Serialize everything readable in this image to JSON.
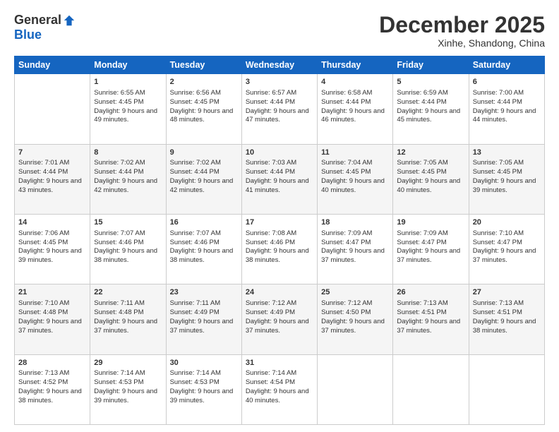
{
  "logo": {
    "general": "General",
    "blue": "Blue"
  },
  "header": {
    "month": "December 2025",
    "location": "Xinhe, Shandong, China"
  },
  "weekdays": [
    "Sunday",
    "Monday",
    "Tuesday",
    "Wednesday",
    "Thursday",
    "Friday",
    "Saturday"
  ],
  "weeks": [
    [
      {
        "day": "",
        "sunrise": "",
        "sunset": "",
        "daylight": ""
      },
      {
        "day": "1",
        "sunrise": "Sunrise: 6:55 AM",
        "sunset": "Sunset: 4:45 PM",
        "daylight": "Daylight: 9 hours and 49 minutes."
      },
      {
        "day": "2",
        "sunrise": "Sunrise: 6:56 AM",
        "sunset": "Sunset: 4:45 PM",
        "daylight": "Daylight: 9 hours and 48 minutes."
      },
      {
        "day": "3",
        "sunrise": "Sunrise: 6:57 AM",
        "sunset": "Sunset: 4:44 PM",
        "daylight": "Daylight: 9 hours and 47 minutes."
      },
      {
        "day": "4",
        "sunrise": "Sunrise: 6:58 AM",
        "sunset": "Sunset: 4:44 PM",
        "daylight": "Daylight: 9 hours and 46 minutes."
      },
      {
        "day": "5",
        "sunrise": "Sunrise: 6:59 AM",
        "sunset": "Sunset: 4:44 PM",
        "daylight": "Daylight: 9 hours and 45 minutes."
      },
      {
        "day": "6",
        "sunrise": "Sunrise: 7:00 AM",
        "sunset": "Sunset: 4:44 PM",
        "daylight": "Daylight: 9 hours and 44 minutes."
      }
    ],
    [
      {
        "day": "7",
        "sunrise": "Sunrise: 7:01 AM",
        "sunset": "Sunset: 4:44 PM",
        "daylight": "Daylight: 9 hours and 43 minutes."
      },
      {
        "day": "8",
        "sunrise": "Sunrise: 7:02 AM",
        "sunset": "Sunset: 4:44 PM",
        "daylight": "Daylight: 9 hours and 42 minutes."
      },
      {
        "day": "9",
        "sunrise": "Sunrise: 7:02 AM",
        "sunset": "Sunset: 4:44 PM",
        "daylight": "Daylight: 9 hours and 42 minutes."
      },
      {
        "day": "10",
        "sunrise": "Sunrise: 7:03 AM",
        "sunset": "Sunset: 4:44 PM",
        "daylight": "Daylight: 9 hours and 41 minutes."
      },
      {
        "day": "11",
        "sunrise": "Sunrise: 7:04 AM",
        "sunset": "Sunset: 4:45 PM",
        "daylight": "Daylight: 9 hours and 40 minutes."
      },
      {
        "day": "12",
        "sunrise": "Sunrise: 7:05 AM",
        "sunset": "Sunset: 4:45 PM",
        "daylight": "Daylight: 9 hours and 40 minutes."
      },
      {
        "day": "13",
        "sunrise": "Sunrise: 7:05 AM",
        "sunset": "Sunset: 4:45 PM",
        "daylight": "Daylight: 9 hours and 39 minutes."
      }
    ],
    [
      {
        "day": "14",
        "sunrise": "Sunrise: 7:06 AM",
        "sunset": "Sunset: 4:45 PM",
        "daylight": "Daylight: 9 hours and 39 minutes."
      },
      {
        "day": "15",
        "sunrise": "Sunrise: 7:07 AM",
        "sunset": "Sunset: 4:46 PM",
        "daylight": "Daylight: 9 hours and 38 minutes."
      },
      {
        "day": "16",
        "sunrise": "Sunrise: 7:07 AM",
        "sunset": "Sunset: 4:46 PM",
        "daylight": "Daylight: 9 hours and 38 minutes."
      },
      {
        "day": "17",
        "sunrise": "Sunrise: 7:08 AM",
        "sunset": "Sunset: 4:46 PM",
        "daylight": "Daylight: 9 hours and 38 minutes."
      },
      {
        "day": "18",
        "sunrise": "Sunrise: 7:09 AM",
        "sunset": "Sunset: 4:47 PM",
        "daylight": "Daylight: 9 hours and 37 minutes."
      },
      {
        "day": "19",
        "sunrise": "Sunrise: 7:09 AM",
        "sunset": "Sunset: 4:47 PM",
        "daylight": "Daylight: 9 hours and 37 minutes."
      },
      {
        "day": "20",
        "sunrise": "Sunrise: 7:10 AM",
        "sunset": "Sunset: 4:47 PM",
        "daylight": "Daylight: 9 hours and 37 minutes."
      }
    ],
    [
      {
        "day": "21",
        "sunrise": "Sunrise: 7:10 AM",
        "sunset": "Sunset: 4:48 PM",
        "daylight": "Daylight: 9 hours and 37 minutes."
      },
      {
        "day": "22",
        "sunrise": "Sunrise: 7:11 AM",
        "sunset": "Sunset: 4:48 PM",
        "daylight": "Daylight: 9 hours and 37 minutes."
      },
      {
        "day": "23",
        "sunrise": "Sunrise: 7:11 AM",
        "sunset": "Sunset: 4:49 PM",
        "daylight": "Daylight: 9 hours and 37 minutes."
      },
      {
        "day": "24",
        "sunrise": "Sunrise: 7:12 AM",
        "sunset": "Sunset: 4:49 PM",
        "daylight": "Daylight: 9 hours and 37 minutes."
      },
      {
        "day": "25",
        "sunrise": "Sunrise: 7:12 AM",
        "sunset": "Sunset: 4:50 PM",
        "daylight": "Daylight: 9 hours and 37 minutes."
      },
      {
        "day": "26",
        "sunrise": "Sunrise: 7:13 AM",
        "sunset": "Sunset: 4:51 PM",
        "daylight": "Daylight: 9 hours and 37 minutes."
      },
      {
        "day": "27",
        "sunrise": "Sunrise: 7:13 AM",
        "sunset": "Sunset: 4:51 PM",
        "daylight": "Daylight: 9 hours and 38 minutes."
      }
    ],
    [
      {
        "day": "28",
        "sunrise": "Sunrise: 7:13 AM",
        "sunset": "Sunset: 4:52 PM",
        "daylight": "Daylight: 9 hours and 38 minutes."
      },
      {
        "day": "29",
        "sunrise": "Sunrise: 7:14 AM",
        "sunset": "Sunset: 4:53 PM",
        "daylight": "Daylight: 9 hours and 39 minutes."
      },
      {
        "day": "30",
        "sunrise": "Sunrise: 7:14 AM",
        "sunset": "Sunset: 4:53 PM",
        "daylight": "Daylight: 9 hours and 39 minutes."
      },
      {
        "day": "31",
        "sunrise": "Sunrise: 7:14 AM",
        "sunset": "Sunset: 4:54 PM",
        "daylight": "Daylight: 9 hours and 40 minutes."
      },
      {
        "day": "",
        "sunrise": "",
        "sunset": "",
        "daylight": ""
      },
      {
        "day": "",
        "sunrise": "",
        "sunset": "",
        "daylight": ""
      },
      {
        "day": "",
        "sunrise": "",
        "sunset": "",
        "daylight": ""
      }
    ]
  ]
}
